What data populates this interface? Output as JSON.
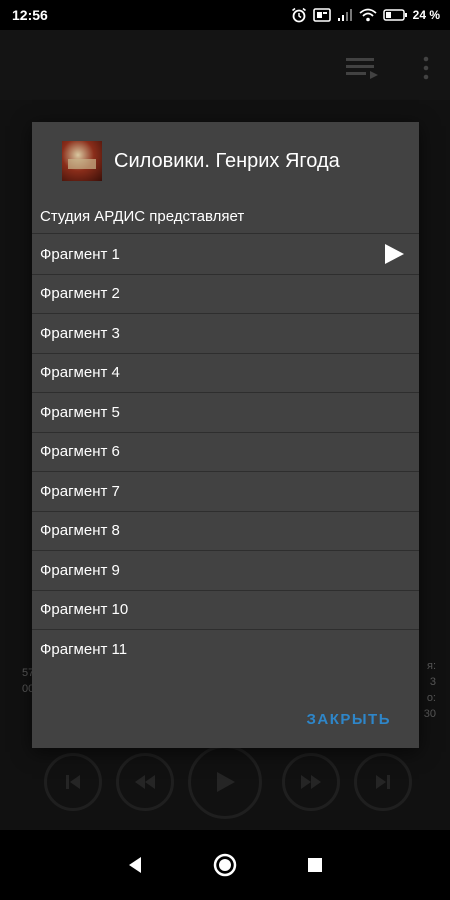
{
  "status_bar": {
    "time": "12:56",
    "battery": "24 %",
    "icons": [
      "alarm-icon",
      "sim-icon",
      "signal-icon",
      "wifi-icon",
      "battery-icon"
    ]
  },
  "app_bar": {
    "icons": [
      "queue-music-icon",
      "more-vert-icon"
    ]
  },
  "background": {
    "left_text": [
      "57",
      "00"
    ],
    "right_text": [
      "я:",
      "3",
      "о:",
      "30"
    ]
  },
  "dialog": {
    "title": "Силовики. Генрих Ягода",
    "subtitle": "Студия АРДИС представляет",
    "items": [
      {
        "label": "Фрагмент  1",
        "playing": true
      },
      {
        "label": "Фрагмент  2"
      },
      {
        "label": "Фрагмент  3"
      },
      {
        "label": "Фрагмент  4"
      },
      {
        "label": "Фрагмент  5"
      },
      {
        "label": "Фрагмент  6"
      },
      {
        "label": "Фрагмент  7"
      },
      {
        "label": "Фрагмент  8"
      },
      {
        "label": "Фрагмент  9"
      },
      {
        "label": "Фрагмент  10"
      },
      {
        "label": "Фрагмент  11"
      }
    ],
    "close_label": "ЗАКРЫТЬ"
  },
  "colors": {
    "accent": "#2e86c9",
    "dialog_bg": "#424242",
    "divider": "#2e2e2e"
  }
}
